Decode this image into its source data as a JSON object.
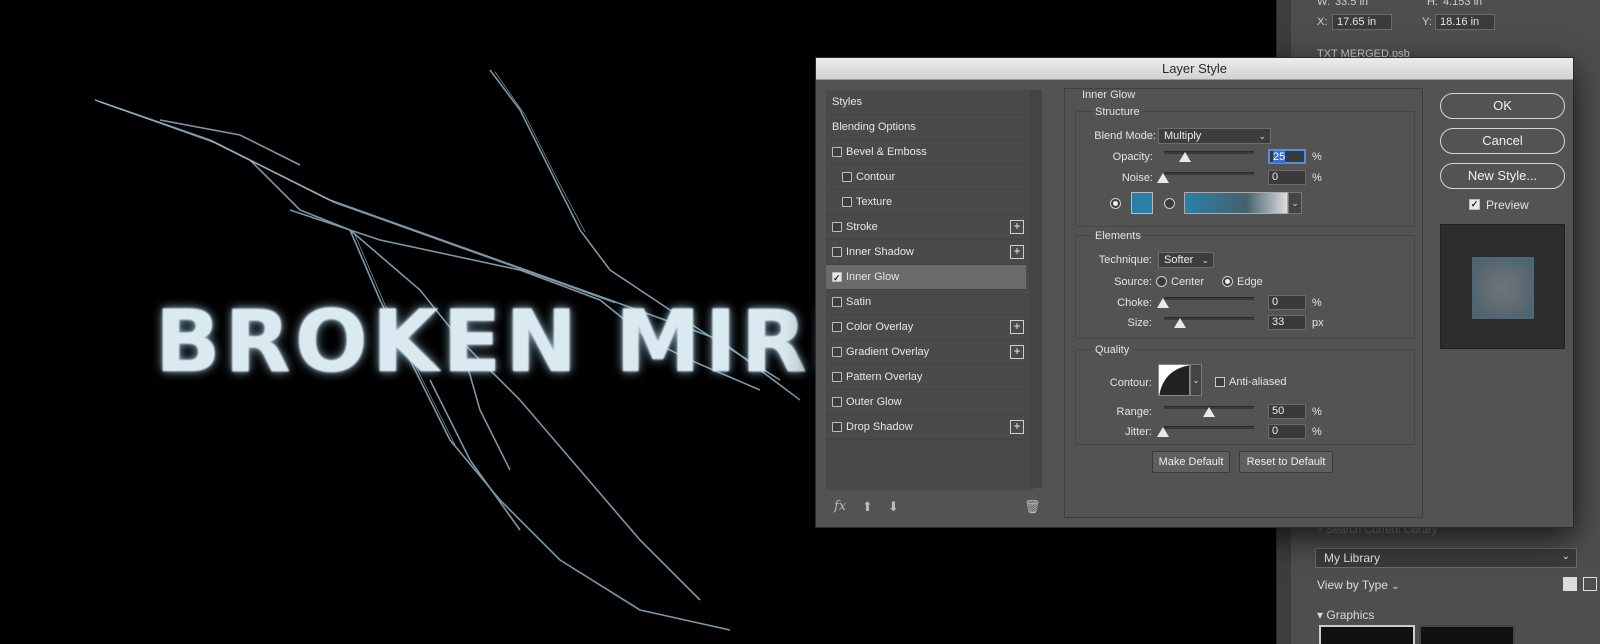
{
  "canvas": {
    "headline": "BROKEN MIRRO"
  },
  "right_panel": {
    "w_label": "W:",
    "w_value": "33.5 in",
    "h_label": "H:",
    "h_value": "4.153 in",
    "x_label": "X:",
    "x_value": "17.65 in",
    "y_label": "Y:",
    "y_value": "18.16 in",
    "file_name": "TXT MERGED.psb",
    "search_placeholder": "Search Current Library",
    "library": "My Library",
    "view_by": "View by Type",
    "graphics_label": "Graphics"
  },
  "dialog": {
    "title": "Layer Style",
    "styles_header": "Styles",
    "blending_options": "Blending Options",
    "styles": [
      {
        "label": "Bevel & Emboss",
        "checked": false
      },
      {
        "label": "Contour",
        "checked": false
      },
      {
        "label": "Texture",
        "checked": false
      },
      {
        "label": "Stroke",
        "checked": false
      },
      {
        "label": "Inner Shadow",
        "checked": false
      },
      {
        "label": "Inner Glow",
        "checked": true
      },
      {
        "label": "Satin",
        "checked": false
      },
      {
        "label": "Color Overlay",
        "checked": false
      },
      {
        "label": "Gradient Overlay",
        "checked": false
      },
      {
        "label": "Pattern Overlay",
        "checked": false
      },
      {
        "label": "Outer Glow",
        "checked": false
      },
      {
        "label": "Drop Shadow",
        "checked": false
      }
    ],
    "footer": {
      "fx": "fx"
    },
    "inner_glow": {
      "section_title": "Inner Glow",
      "structure_title": "Structure",
      "blend_mode_label": "Blend Mode:",
      "blend_mode": "Multiply",
      "opacity_label": "Opacity:",
      "opacity": "25",
      "noise_label": "Noise:",
      "noise": "0",
      "percent": "%",
      "px": "px",
      "glow_color": "#2a7fa8",
      "elements_title": "Elements",
      "technique_label": "Technique:",
      "technique": "Softer",
      "source_label": "Source:",
      "source_center": "Center",
      "source_edge": "Edge",
      "choke_label": "Choke:",
      "choke": "0",
      "size_label": "Size:",
      "size": "33",
      "quality_title": "Quality",
      "contour_label": "Contour:",
      "anti_aliased": "Anti-aliased",
      "range_label": "Range:",
      "range": "50",
      "jitter_label": "Jitter:",
      "jitter": "0",
      "make_default": "Make Default",
      "reset_default": "Reset to Default"
    },
    "buttons": {
      "ok": "OK",
      "cancel": "Cancel",
      "new_style": "New Style...",
      "preview": "Preview"
    }
  }
}
